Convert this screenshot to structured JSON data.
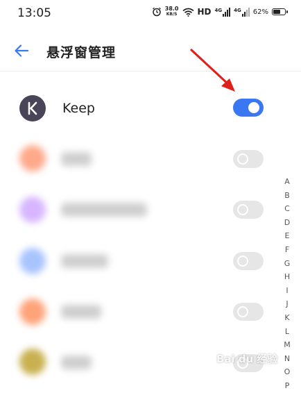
{
  "status_bar": {
    "time": "13:05",
    "net_speed_value": "38.0",
    "net_speed_unit": "KB/S",
    "hd_label": "HD",
    "signal1_label": "4G",
    "signal2_label": "4G",
    "battery_percent": "62%",
    "icons": [
      "alarm-icon",
      "wifi-icon",
      "signal-icon",
      "battery-icon"
    ]
  },
  "header": {
    "back_icon": "arrow-left-icon",
    "title": "悬浮窗管理"
  },
  "apps": [
    {
      "name": "Keep",
      "enabled": true,
      "icon_color": "#4a4458"
    },
    {
      "name": "",
      "enabled": false,
      "icon_color": "#ffa98a",
      "blurred": true
    },
    {
      "name": "",
      "enabled": false,
      "icon_color": "#d7b6ff",
      "blurred": true
    },
    {
      "name": "",
      "enabled": false,
      "icon_color": "#a8c4ff",
      "blurred": true
    },
    {
      "name": "",
      "enabled": false,
      "icon_color": "#ffa37a",
      "blurred": true
    },
    {
      "name": "",
      "enabled": false,
      "icon_color": "#c9b150",
      "blurred": true
    }
  ],
  "alphabet_index": [
    "A",
    "B",
    "C",
    "D",
    "E",
    "F",
    "G",
    "H",
    "I",
    "J",
    "K",
    "L",
    "M",
    "N",
    "O",
    "P"
  ],
  "annotation": {
    "type": "red-arrow",
    "color": "#e0201a"
  },
  "watermark": {
    "text": "Bai du 经验"
  },
  "colors": {
    "accent": "#3a77f2",
    "toggle_off": "#e6e6e6",
    "divider": "#eeeeee"
  }
}
